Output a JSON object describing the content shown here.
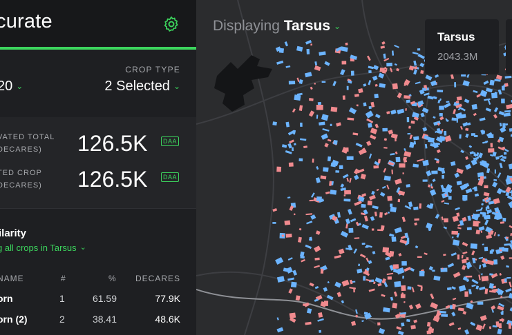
{
  "app": {
    "logo_text": "curate"
  },
  "filters": {
    "year_value": "20",
    "crop_type_label": "CROP TYPE",
    "crop_type_value": "2 Selected"
  },
  "stats": [
    {
      "label_line1": "VATED TOTAL",
      "label_line2": "DECARES)",
      "value": "126.5K",
      "unit": "DAA"
    },
    {
      "label_line1": "TED CROP",
      "label_line2": "DECARES)",
      "value": "126.5K",
      "unit": "DAA"
    }
  ],
  "similarity": {
    "title": "ilarity",
    "link": "g all crops in Tarsus",
    "columns": {
      "name": "NAME",
      "num": "#",
      "pct": "%",
      "decares": "DECARES"
    },
    "rows": [
      {
        "name": "orn",
        "num": "1",
        "pct": "61.59",
        "decares": "77.9K"
      },
      {
        "name": "orn (2)",
        "num": "2",
        "pct": "38.41",
        "decares": "48.6K"
      }
    ]
  },
  "map": {
    "displaying_label": "Displaying",
    "location": "Tarsus",
    "tooltip": {
      "title": "Tarsus",
      "value": "2043.3M"
    },
    "crop_colors": [
      "#6cb4ff",
      "#f08a8e"
    ]
  },
  "colors": {
    "accent": "#3cd55d",
    "sidebar_bg": "#1e1f22",
    "map_bg": "#2b2c2e"
  },
  "icons": {
    "settings": "gear-icon",
    "dropdown": "chevron-down-icon"
  }
}
